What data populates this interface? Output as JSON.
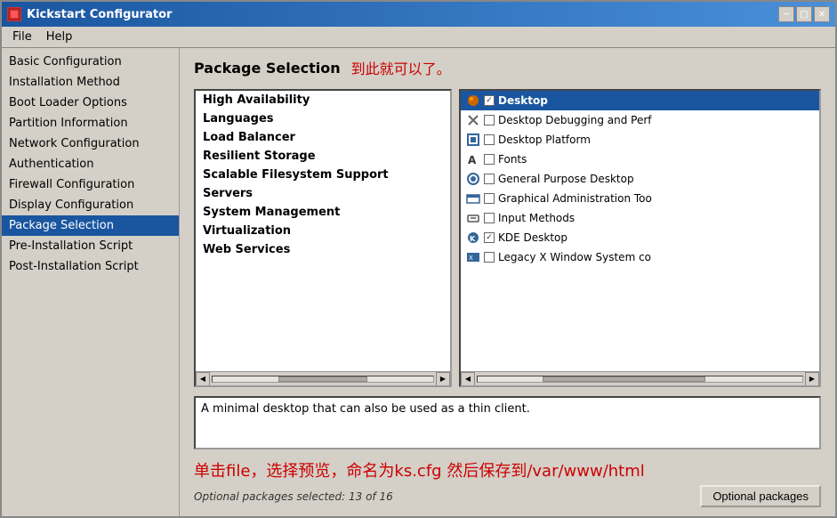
{
  "window": {
    "title": "Kickstart Configurator"
  },
  "menu": {
    "items": [
      {
        "id": "file",
        "label": "File"
      },
      {
        "id": "help",
        "label": "Help"
      }
    ]
  },
  "sidebar": {
    "items": [
      {
        "id": "basic-config",
        "label": "Basic Configuration",
        "active": false
      },
      {
        "id": "installation-method",
        "label": "Installation Method",
        "active": false
      },
      {
        "id": "boot-loader",
        "label": "Boot Loader Options",
        "active": false
      },
      {
        "id": "partition-info",
        "label": "Partition Information",
        "active": false
      },
      {
        "id": "network-config",
        "label": "Network Configuration",
        "active": false
      },
      {
        "id": "authentication",
        "label": "Authentication",
        "active": false
      },
      {
        "id": "firewall-config",
        "label": "Firewall Configuration",
        "active": false
      },
      {
        "id": "display-config",
        "label": "Display Configuration",
        "active": false
      },
      {
        "id": "package-selection",
        "label": "Package Selection",
        "active": true
      },
      {
        "id": "pre-install",
        "label": "Pre-Installation Script",
        "active": false
      },
      {
        "id": "post-install",
        "label": "Post-Installation Script",
        "active": false
      }
    ]
  },
  "main": {
    "page_title": "Package Selection",
    "page_annotation": "到此就可以了。",
    "left_packages": [
      "High Availability",
      "Languages",
      "Load Balancer",
      "Resilient Storage",
      "Scalable Filesystem Support",
      "Servers",
      "System Management",
      "Virtualization",
      "Web Services"
    ],
    "right_packages": [
      {
        "label": "Desktop",
        "checked": true,
        "header": true
      },
      {
        "label": "Desktop Debugging and Perf",
        "checked": false,
        "header": false
      },
      {
        "label": "Desktop Platform",
        "checked": false,
        "header": false
      },
      {
        "label": "Fonts",
        "checked": false,
        "header": false
      },
      {
        "label": "General Purpose Desktop",
        "checked": false,
        "header": false
      },
      {
        "label": "Graphical Administration Too",
        "checked": false,
        "header": false
      },
      {
        "label": "Input Methods",
        "checked": false,
        "header": false
      },
      {
        "label": "KDE Desktop",
        "checked": true,
        "header": false
      },
      {
        "label": "Legacy X Window System co",
        "checked": false,
        "header": false
      }
    ],
    "description": "A minimal desktop that can also be used as a thin client.",
    "annotation": "单击file，选择预览，命名为ks.cfg 然后保存到/var/www/html",
    "optional_count_label": "Optional packages selected: 13 of 16",
    "optional_btn_label": "Optional packages"
  },
  "colors": {
    "accent_blue": "#1a56a0",
    "red_annotation": "#cc0000"
  },
  "icons": {
    "minimize": "─",
    "maximize": "□",
    "close": "✕",
    "arrow_left": "◀",
    "arrow_right": "▶"
  }
}
